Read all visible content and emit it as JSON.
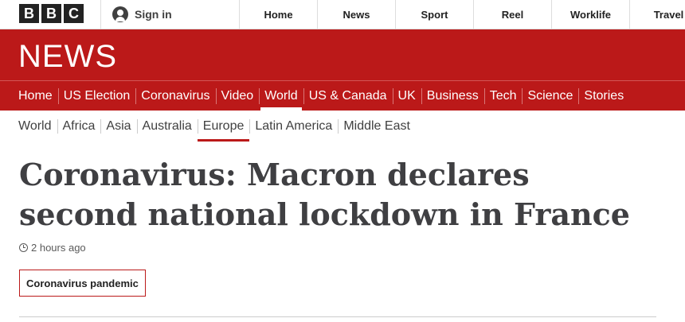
{
  "masthead": {
    "logo_letters": [
      "B",
      "B",
      "C"
    ],
    "signin_label": "Sign in",
    "nav": [
      "Home",
      "News",
      "Sport",
      "Reel",
      "Worklife",
      "Travel"
    ]
  },
  "banner": {
    "title": "NEWS"
  },
  "section_nav": {
    "items": [
      "Home",
      "US Election",
      "Coronavirus",
      "Video",
      "World",
      "US & Canada",
      "UK",
      "Business",
      "Tech",
      "Science",
      "Stories"
    ],
    "active": "World"
  },
  "sub_nav": {
    "items": [
      "World",
      "Africa",
      "Asia",
      "Australia",
      "Europe",
      "Latin America",
      "Middle East"
    ],
    "active": "Europe"
  },
  "article": {
    "headline": "Coronavirus: Macron declares second national lockdown in France",
    "timestamp": "2 hours ago",
    "tag": "Coronavirus pandemic"
  },
  "colors": {
    "brand_red": "#bb1919"
  }
}
